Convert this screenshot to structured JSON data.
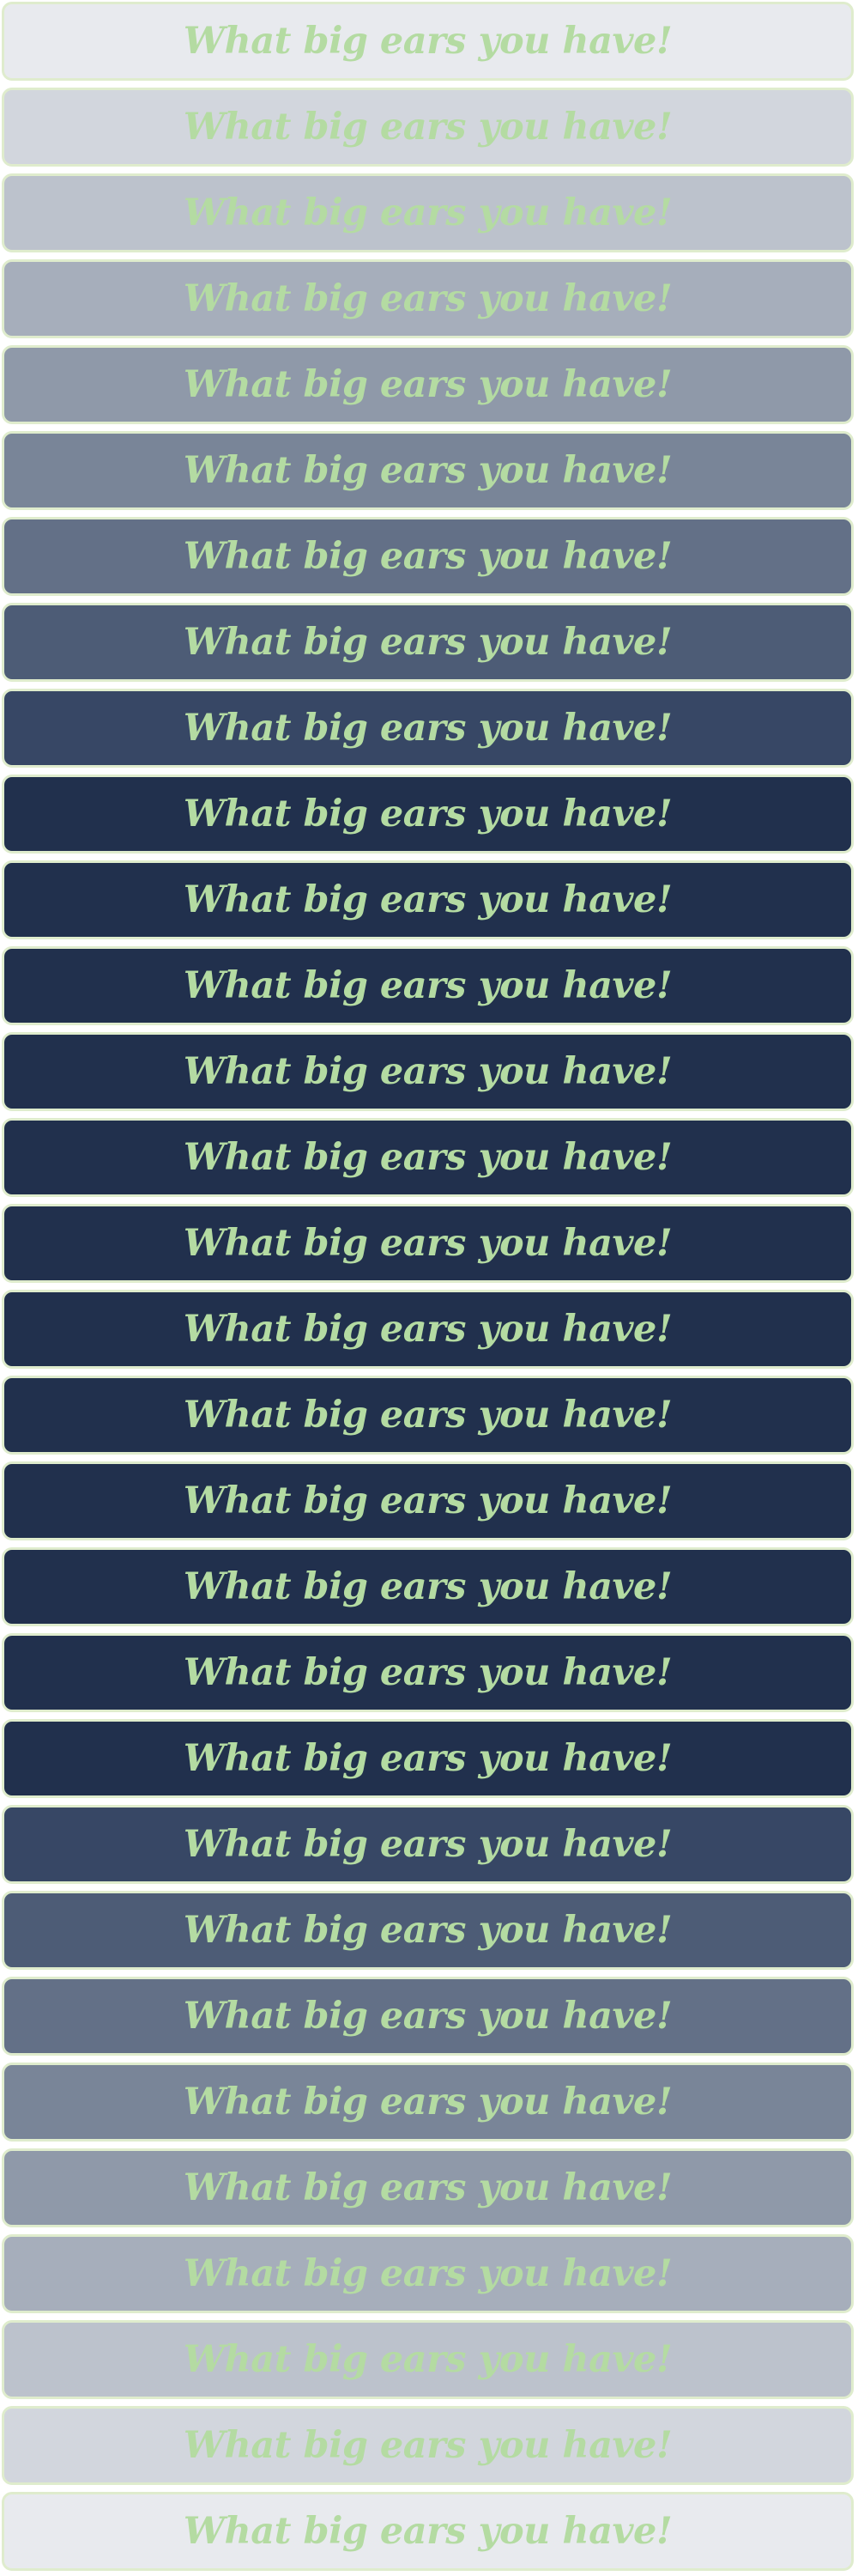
{
  "text_color": "#b4dba2",
  "border_color": "#dfeccd",
  "banners": [
    {
      "text": "What big ears you have!",
      "bg": "#e8eaee"
    },
    {
      "text": "What big ears you have!",
      "bg": "#d2d6dd"
    },
    {
      "text": "What big ears you have!",
      "bg": "#bcc2cc"
    },
    {
      "text": "What big ears you have!",
      "bg": "#a6aebb"
    },
    {
      "text": "What big ears you have!",
      "bg": "#8f99a9"
    },
    {
      "text": "What big ears you have!",
      "bg": "#798598"
    },
    {
      "text": "What big ears you have!",
      "bg": "#637087"
    },
    {
      "text": "What big ears you have!",
      "bg": "#4d5c76"
    },
    {
      "text": "What big ears you have!",
      "bg": "#374765"
    },
    {
      "text": "What big ears you have!",
      "bg": "#21304d"
    },
    {
      "text": "What big ears you have!",
      "bg": "#21304d"
    },
    {
      "text": "What big ears you have!",
      "bg": "#21304d"
    },
    {
      "text": "What big ears you have!",
      "bg": "#21304d"
    },
    {
      "text": "What big ears you have!",
      "bg": "#21304d"
    },
    {
      "text": "What big ears you have!",
      "bg": "#21304d"
    },
    {
      "text": "What big ears you have!",
      "bg": "#21304d"
    },
    {
      "text": "What big ears you have!",
      "bg": "#21304d"
    },
    {
      "text": "What big ears you have!",
      "bg": "#21304d"
    },
    {
      "text": "What big ears you have!",
      "bg": "#21304d"
    },
    {
      "text": "What big ears you have!",
      "bg": "#21304d"
    },
    {
      "text": "What big ears you have!",
      "bg": "#21304d"
    },
    {
      "text": "What big ears you have!",
      "bg": "#374765"
    },
    {
      "text": "What big ears you have!",
      "bg": "#4d5c76"
    },
    {
      "text": "What big ears you have!",
      "bg": "#637087"
    },
    {
      "text": "What big ears you have!",
      "bg": "#798598"
    },
    {
      "text": "What big ears you have!",
      "bg": "#8f99a9"
    },
    {
      "text": "What big ears you have!",
      "bg": "#a6aebb"
    },
    {
      "text": "What big ears you have!",
      "bg": "#bcc2cc"
    },
    {
      "text": "What big ears you have!",
      "bg": "#d2d6dd"
    },
    {
      "text": "What big ears you have!",
      "bg": "#e8eaee"
    }
  ]
}
